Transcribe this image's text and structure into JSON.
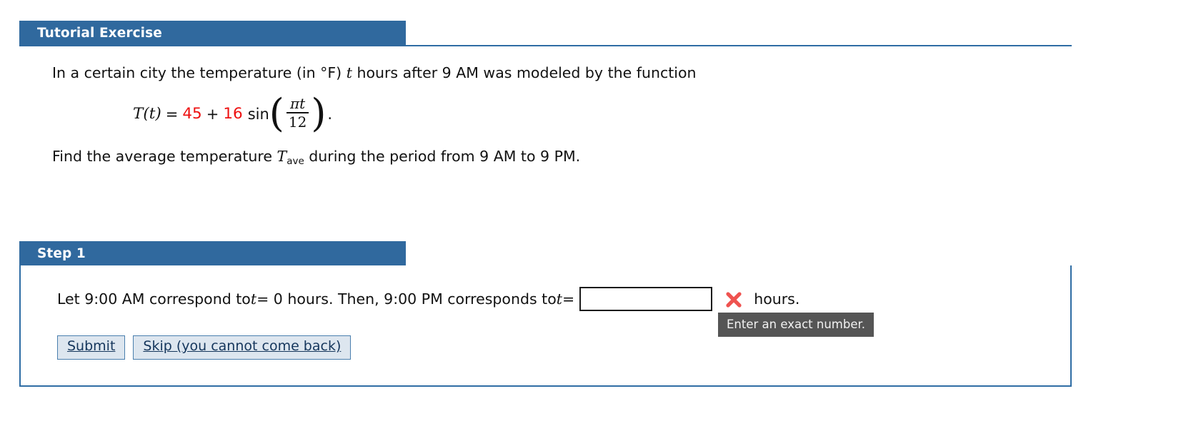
{
  "tutorial": {
    "header": "Tutorial Exercise",
    "problem": {
      "line1_a": "In a certain city the temperature (in °F) ",
      "line1_var": "t",
      "line1_b": " hours after 9 AM was modeled by the function",
      "formula": {
        "function_name": "T",
        "open_paren": "(",
        "arg": "t",
        "close_paren": ")",
        "equals": "=",
        "constant": "45",
        "plus": "+",
        "amplitude": "16",
        "sin_label": "sin",
        "numerator": "πt",
        "denominator": "12",
        "period": ".",
        "red_color": "#ee1111"
      },
      "line3_a": "Find the average temperature ",
      "line3_sym": "T",
      "line3_sub": "ave",
      "line3_b": " during the period from 9 AM to 9 PM."
    }
  },
  "step": {
    "header": "Step 1",
    "prompt_a": "Let 9:00 AM correspond to ",
    "prompt_var1": "t",
    "prompt_b": " = 0 hours. Then, 9:00 PM corresponds to ",
    "prompt_var2": "t",
    "prompt_c": " =",
    "input_value": "",
    "input_placeholder": "",
    "status_icon": "red-x-icon",
    "status_color": "#ef5350",
    "units_label": "hours.",
    "tooltip": "Enter an exact number.",
    "submit_label": "Submit",
    "skip_label": "Skip (you cannot come back)"
  },
  "theme": {
    "header_blue": "#30699e",
    "border_blue": "#2f6da4",
    "button_bg": "#dde6ef",
    "tooltip_bg": "#555555"
  }
}
